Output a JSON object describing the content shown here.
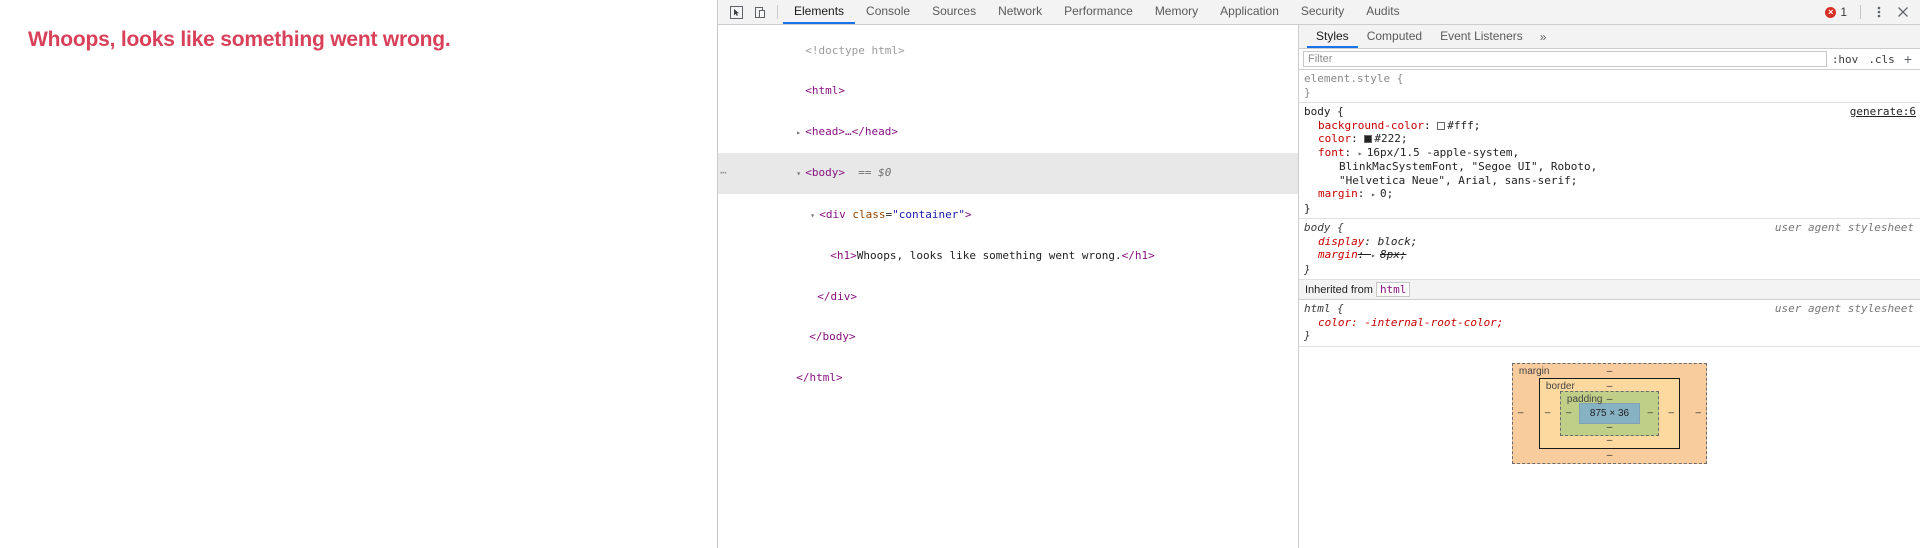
{
  "page": {
    "heading": "Whoops, looks like something went wrong.",
    "heading_color": "#d9405a"
  },
  "devtools": {
    "toolbar": {
      "inspect_icon": "inspect-cursor-icon",
      "device_icon": "device-toolbar-icon",
      "tabs": [
        {
          "label": "Elements",
          "active": true
        },
        {
          "label": "Console",
          "active": false
        },
        {
          "label": "Sources",
          "active": false
        },
        {
          "label": "Network",
          "active": false
        },
        {
          "label": "Performance",
          "active": false
        },
        {
          "label": "Memory",
          "active": false
        },
        {
          "label": "Application",
          "active": false
        },
        {
          "label": "Security",
          "active": false
        },
        {
          "label": "Audits",
          "active": false
        }
      ],
      "error_count": "1",
      "error_glyph": "×",
      "more_icon": "kebab-menu-icon",
      "close_icon": "close-icon",
      "accent_color": "#1a73e8",
      "error_color": "#d93025"
    },
    "dom_tree": {
      "lines": [
        {
          "indent": 0,
          "text": "<!doctype html>",
          "kind": "doctype"
        },
        {
          "indent": 0,
          "text": "<html>",
          "kind": "tag"
        },
        {
          "indent": 1,
          "text": "<head>…</head>",
          "kind": "collapsed",
          "twisty": "▸"
        },
        {
          "indent": 1,
          "text": "<body> == $0",
          "kind": "selected",
          "twisty": "▾"
        },
        {
          "indent": 2,
          "text": "<div class=\"container\">",
          "kind": "open",
          "twisty": "▾"
        },
        {
          "indent": 3,
          "text": "<h1>Whoops, looks like something went wrong.</h1>",
          "kind": "textnode"
        },
        {
          "indent": 2,
          "text": "</div>",
          "kind": "close"
        },
        {
          "indent": 1,
          "text": "</body>",
          "kind": "close"
        },
        {
          "indent": 0,
          "text": "</html>",
          "kind": "close"
        }
      ],
      "dom_tokens": {
        "doctype": "<!doctype html>",
        "html_open": "<html>",
        "head_collapsed": "<head>…</head>",
        "body_open": "<body>",
        "selected_marker": "== $0",
        "div_tag_open": "<div",
        "div_attr_name": "class",
        "div_attr_value": "\"container\"",
        "div_tag_close": ">",
        "h1_open": "<h1>",
        "h1_text": "Whoops, looks like something went wrong.",
        "h1_close": "</h1>",
        "div_close": "</div>",
        "body_close": "</body>",
        "html_close": "</html>",
        "ellipsis_badge": "⋯"
      }
    },
    "styles": {
      "tabs": [
        {
          "label": "Styles",
          "active": true
        },
        {
          "label": "Computed",
          "active": false
        },
        {
          "label": "Event Listeners",
          "active": false
        }
      ],
      "more_tabs_glyph": "»",
      "filter": {
        "placeholder": "Filter",
        "value": "",
        "hov_label": ":hov",
        "cls_label": ".cls",
        "new_rule_glyph": "+"
      },
      "rules": [
        {
          "selector": "element.style {",
          "close": "}",
          "origin": "",
          "origin_link": "",
          "declarations": []
        },
        {
          "selector": "body {",
          "close": "}",
          "origin": "",
          "origin_link": "generate:6",
          "declarations": [
            {
              "name": "background-color",
              "value": "#fff",
              "swatch": "#ffffff",
              "struck": false,
              "expand": false
            },
            {
              "name": "color",
              "value": "#222",
              "swatch": "#222222",
              "struck": false,
              "expand": false
            },
            {
              "name": "font",
              "value": "16px/1.5 -apple-system,",
              "struck": false,
              "expand": true,
              "continuation": [
                "BlinkMacSystemFont, \"Segoe UI\", Roboto,",
                "\"Helvetica Neue\", Arial, sans-serif;"
              ]
            },
            {
              "name": "margin",
              "value": "0",
              "struck": false,
              "expand": true
            }
          ]
        },
        {
          "selector": "body {",
          "close": "}",
          "origin": "user agent stylesheet",
          "origin_link": "",
          "italic": true,
          "declarations": [
            {
              "name": "display",
              "value": "block",
              "struck": false,
              "expand": false
            },
            {
              "name": "margin",
              "value": "8px",
              "struck": true,
              "expand": true
            }
          ]
        }
      ],
      "inherited_from_label": "Inherited from",
      "inherited_from_chip": "html",
      "inherited_rule": {
        "selector": "html {",
        "close": "}",
        "origin": "user agent stylesheet",
        "declaration": "color: -internal-root-color;"
      }
    },
    "box_model": {
      "margin_label": "margin",
      "border_label": "border",
      "padding_label": "padding",
      "content": "875 × 36",
      "dash": "–",
      "colors": {
        "margin": "#f9cc9d",
        "border": "#fdd9a0",
        "padding": "#c0cf88",
        "content": "#87b2c4"
      }
    }
  }
}
